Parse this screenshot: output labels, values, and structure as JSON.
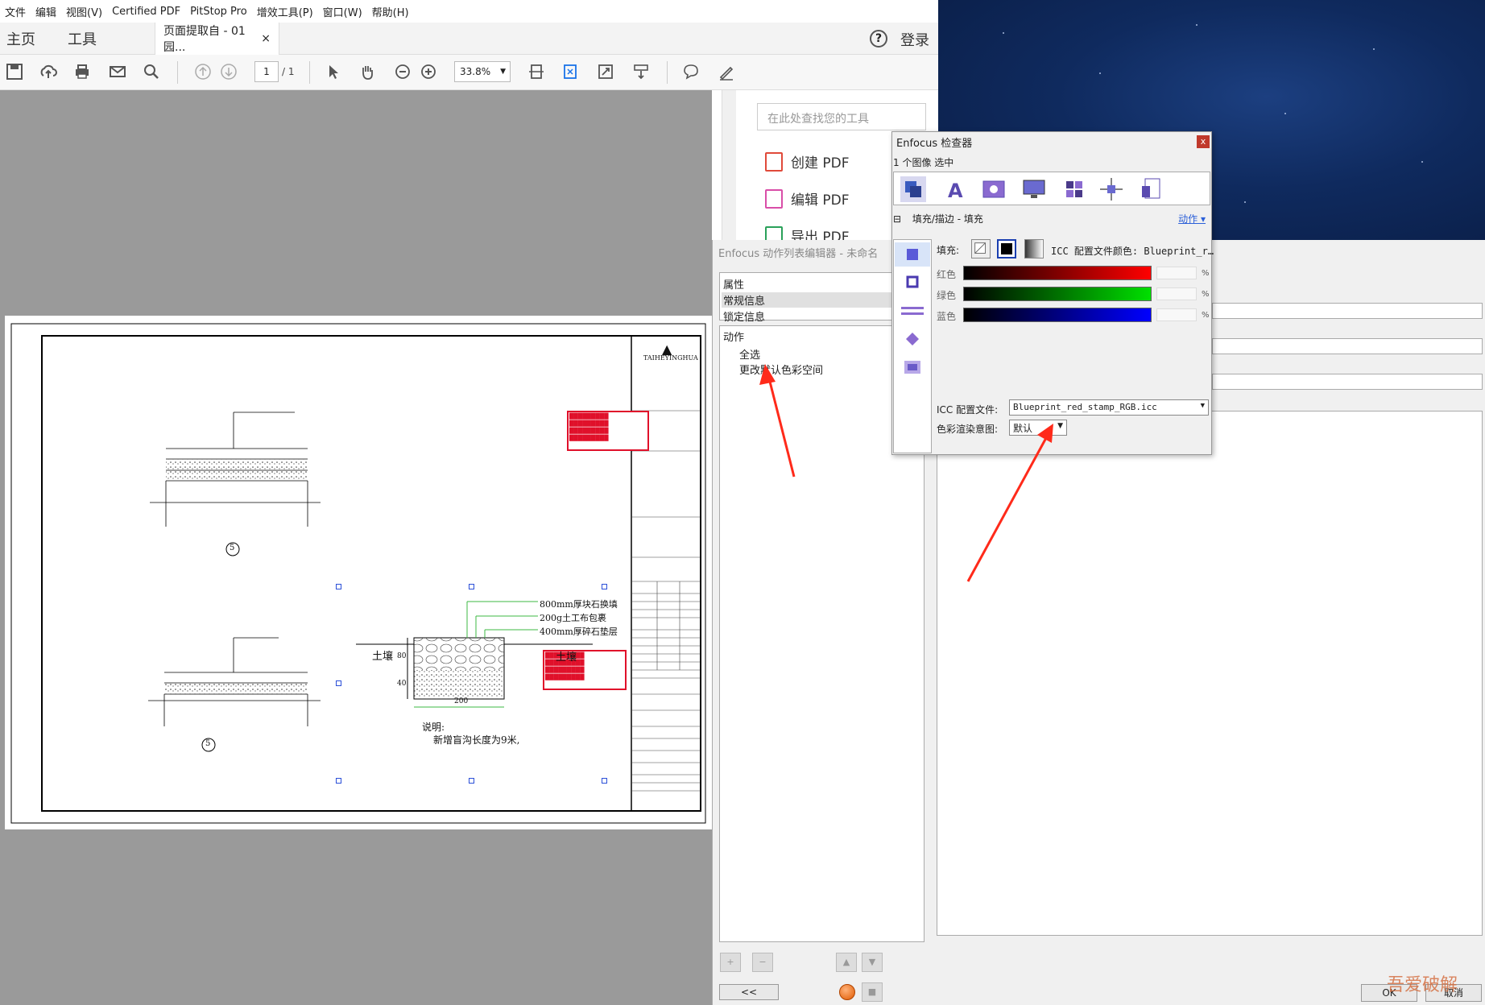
{
  "menu": [
    "文件",
    "编辑",
    "视图(V)",
    "Certified PDF",
    "PitStop Pro",
    "增效工具(P)",
    "窗口(W)",
    "帮助(H)"
  ],
  "nav": {
    "home": "主页",
    "tools": "工具",
    "doc_tab": "页面提取自 - 01 园...",
    "close": "×",
    "help": "?",
    "login": "登录"
  },
  "toolbar": {
    "page_current": "1",
    "page_total": "/ 1",
    "zoom": "33.8%"
  },
  "tools_pane": {
    "search_placeholder": "在此处查找您的工具",
    "items": [
      {
        "label": "创建 PDF",
        "color": "#e04a3a"
      },
      {
        "label": "编辑 PDF",
        "color": "#d94ea8"
      },
      {
        "label": "导出 PDF",
        "color": "#2aa15a"
      }
    ]
  },
  "drawing": {
    "brand": "TAIHEYINGHUA",
    "note_title": "说明:",
    "note_body": "新增盲沟长度为9米,",
    "layer1": "800mm厚块石换填",
    "layer2": "200g土工布包裹",
    "layer3": "400mm厚碎石垫层",
    "soil_left": "土壤",
    "soil_right": "土壤",
    "detail1_no": "5",
    "detail2_no": "5",
    "dim_bottom": "200",
    "dim_side_top": "80",
    "dim_side_bottom": "40"
  },
  "action_editor": {
    "title": "Enfocus 动作列表编辑器 - 未命名",
    "properties": [
      "属性",
      "常规信息",
      "锁定信息"
    ],
    "actions_header": "动作",
    "actions": [
      "全选",
      "更改默认色彩空间"
    ],
    "collapse": "<<",
    "ok": "OK",
    "cancel": "取消"
  },
  "inspector": {
    "title": "Enfocus 检查器",
    "close": "x",
    "selection": "1 个图像  选中",
    "section": "填充/描边 - 填充",
    "actions_link": "动作 ▾",
    "fill_label": "填充:",
    "icc_color_label": "ICC 配置文件颜色:  Blueprint_r…",
    "channels": [
      {
        "label": "红色",
        "color": "#ff0000",
        "pct": "%"
      },
      {
        "label": "绿色",
        "color": "#00e000",
        "pct": "%"
      },
      {
        "label": "蓝色",
        "color": "#0000ff",
        "pct": "%"
      }
    ],
    "icc_profile_label": "ICC 配置文件:",
    "icc_profile_value": "Blueprint_red_stamp_RGB.icc",
    "intent_label": "色彩渲染意图:",
    "intent_value": "默认"
  },
  "accent": {
    "arrow": "#ff2a1a",
    "stamp": "#e0102a",
    "selection": "#2b4fd8"
  },
  "watermark": "吾爱破解"
}
